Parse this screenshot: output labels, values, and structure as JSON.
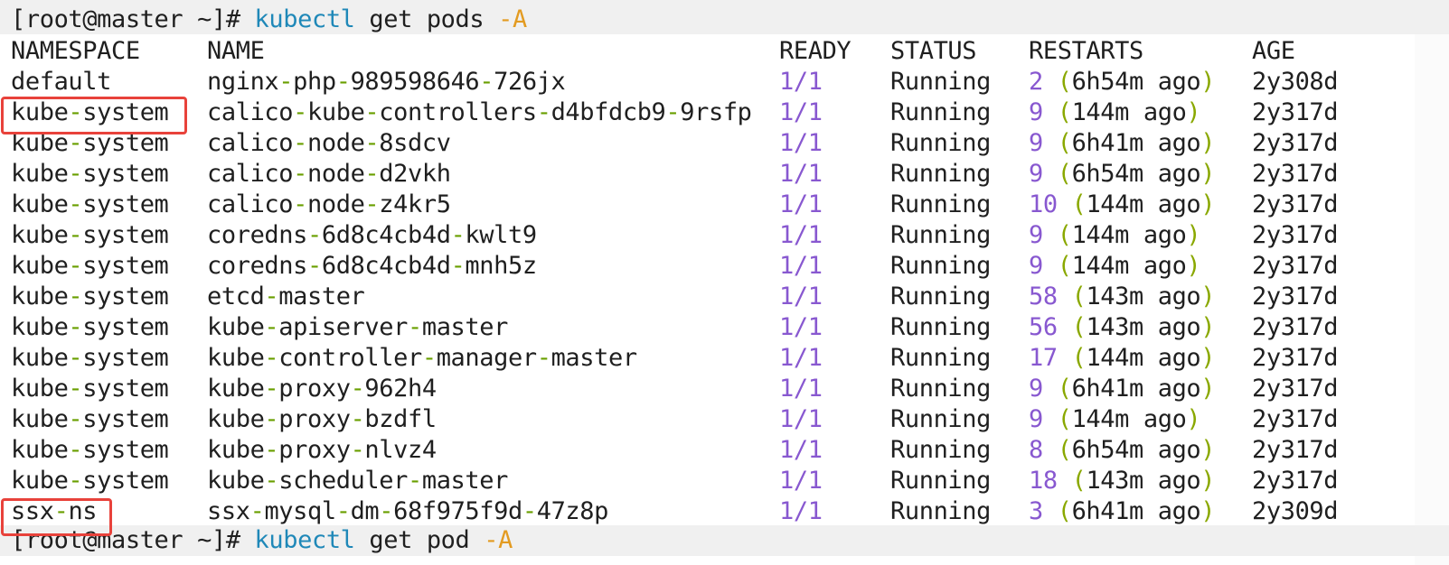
{
  "terminal": {
    "colors": {
      "background": "#ffffff",
      "text": "#1f1f1f",
      "dash": "#6a9f00",
      "number": "#8858d0",
      "paren": "#8aa800",
      "command": "#1f88b8",
      "flag": "#e39b21",
      "highlight": "#e8423b"
    },
    "prompt_first": {
      "prefix": "[root@master ~]# ",
      "cmd": "kubectl",
      "args": " get pods ",
      "flag": "-A"
    },
    "headers": {
      "namespace": "NAMESPACE",
      "name": "NAME",
      "ready": "READY",
      "status": "STATUS",
      "restarts": "RESTARTS",
      "age": "AGE"
    },
    "rows": [
      {
        "namespace": "default",
        "name": "nginx-php-989598646-726jx",
        "ready": "1/1",
        "status": "Running",
        "restarts": "2",
        "restarts_when": "6h54m ago",
        "age": "2y308d"
      },
      {
        "namespace": "kube-system",
        "name": "calico-kube-controllers-d4bfdcb9-9rsfp",
        "ready": "1/1",
        "status": "Running",
        "restarts": "9",
        "restarts_when": "144m ago",
        "age": "2y317d"
      },
      {
        "namespace": "kube-system",
        "name": "calico-node-8sdcv",
        "ready": "1/1",
        "status": "Running",
        "restarts": "9",
        "restarts_when": "6h41m ago",
        "age": "2y317d"
      },
      {
        "namespace": "kube-system",
        "name": "calico-node-d2vkh",
        "ready": "1/1",
        "status": "Running",
        "restarts": "9",
        "restarts_when": "6h54m ago",
        "age": "2y317d"
      },
      {
        "namespace": "kube-system",
        "name": "calico-node-z4kr5",
        "ready": "1/1",
        "status": "Running",
        "restarts": "10",
        "restarts_when": "144m ago",
        "age": "2y317d"
      },
      {
        "namespace": "kube-system",
        "name": "coredns-6d8c4cb4d-kwlt9",
        "ready": "1/1",
        "status": "Running",
        "restarts": "9",
        "restarts_when": "144m ago",
        "age": "2y317d"
      },
      {
        "namespace": "kube-system",
        "name": "coredns-6d8c4cb4d-mnh5z",
        "ready": "1/1",
        "status": "Running",
        "restarts": "9",
        "restarts_when": "144m ago",
        "age": "2y317d"
      },
      {
        "namespace": "kube-system",
        "name": "etcd-master",
        "ready": "1/1",
        "status": "Running",
        "restarts": "58",
        "restarts_when": "143m ago",
        "age": "2y317d"
      },
      {
        "namespace": "kube-system",
        "name": "kube-apiserver-master",
        "ready": "1/1",
        "status": "Running",
        "restarts": "56",
        "restarts_when": "143m ago",
        "age": "2y317d"
      },
      {
        "namespace": "kube-system",
        "name": "kube-controller-manager-master",
        "ready": "1/1",
        "status": "Running",
        "restarts": "17",
        "restarts_when": "144m ago",
        "age": "2y317d"
      },
      {
        "namespace": "kube-system",
        "name": "kube-proxy-962h4",
        "ready": "1/1",
        "status": "Running",
        "restarts": "9",
        "restarts_when": "6h41m ago",
        "age": "2y317d"
      },
      {
        "namespace": "kube-system",
        "name": "kube-proxy-bzdfl",
        "ready": "1/1",
        "status": "Running",
        "restarts": "9",
        "restarts_when": "144m ago",
        "age": "2y317d"
      },
      {
        "namespace": "kube-system",
        "name": "kube-proxy-nlvz4",
        "ready": "1/1",
        "status": "Running",
        "restarts": "8",
        "restarts_when": "6h54m ago",
        "age": "2y317d"
      },
      {
        "namespace": "kube-system",
        "name": "kube-scheduler-master",
        "ready": "1/1",
        "status": "Running",
        "restarts": "18",
        "restarts_when": "143m ago",
        "age": "2y317d"
      },
      {
        "namespace": "ssx-ns",
        "name": "ssx-mysql-dm-68f975f9d-47z8p",
        "ready": "1/1",
        "status": "Running",
        "restarts": "3",
        "restarts_when": "6h41m ago",
        "age": "2y309d"
      }
    ],
    "prompt_last": {
      "prefix": "[root@master ~]# ",
      "cmd": "kubectl",
      "args": " get pod ",
      "flag": "-A"
    },
    "highlighted_namespaces": [
      "kube-system",
      "ssx-ns"
    ]
  }
}
